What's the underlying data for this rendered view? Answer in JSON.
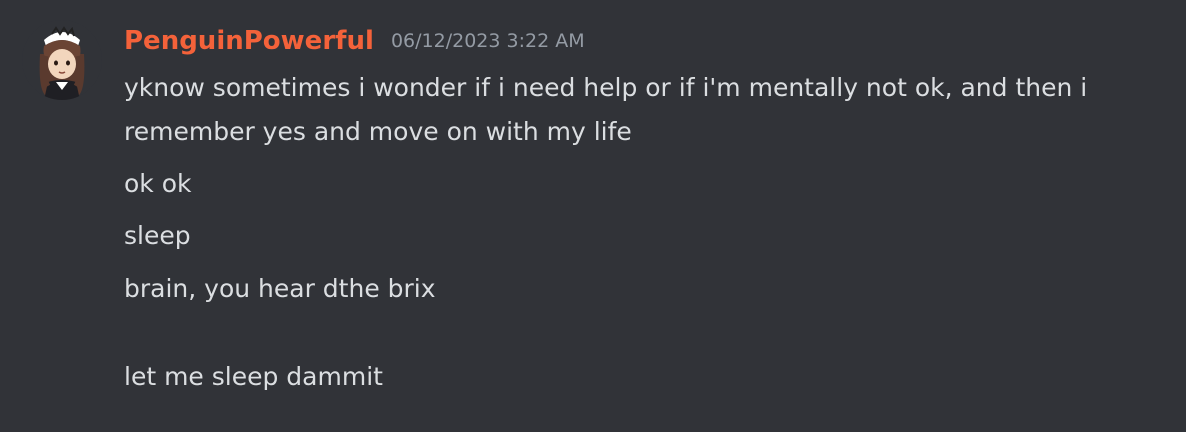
{
  "author": {
    "username": "PenguinPowerful",
    "timestamp": "06/12/2023 3:22 AM",
    "name_color": "#f4623a",
    "avatar_icon": "penguin-maid-avatar-icon"
  },
  "messages": [
    {
      "text": "yknow sometimes i wonder if i need help or if i'm mentally not ok, and then i\nremember yes and move on with my life"
    },
    {
      "text": "ok ok"
    },
    {
      "text": "sleep"
    },
    {
      "text": "brain, you hear dthe brix\n\nlet me sleep dammit"
    }
  ],
  "theme": {
    "background": "#313338",
    "text": "#dbdee1",
    "muted": "#949ba4"
  }
}
